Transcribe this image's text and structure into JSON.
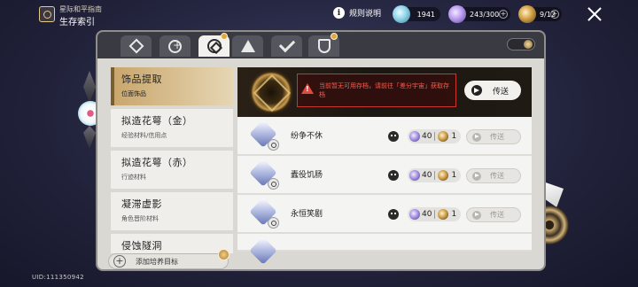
{
  "header": {
    "guide_title": "星际和平指南",
    "guide_subtitle": "生存索引",
    "rules_label": "规则说明",
    "resources": [
      {
        "value": "1941",
        "icon": "stellar-jade-icon"
      },
      {
        "value": "243/300",
        "icon": "trailblaze-power-icon"
      },
      {
        "value": "9/12",
        "icon": "fuel-icon"
      }
    ]
  },
  "sidebar": {
    "items": [
      {
        "name": "饰品提取",
        "sub": "位面饰品",
        "active": true
      },
      {
        "name": "拟造花萼（金）",
        "sub": "经验材料/信用点"
      },
      {
        "name": "拟造花萼（赤）",
        "sub": "行迹材料"
      },
      {
        "name": "凝滞虚影",
        "sub": "角色晋阶材料"
      },
      {
        "name": "侵蚀隧洞",
        "sub": ""
      }
    ],
    "add_target": "添加培养目标"
  },
  "banner": {
    "warning": "当前暂无可用存档，请前往「差分宇宙」获取存档",
    "send_label": "传送"
  },
  "rows": [
    {
      "name": "纷争不休",
      "cost": "40",
      "count": "1",
      "send": "传送"
    },
    {
      "name": "蠹役饥肠",
      "cost": "40",
      "count": "1",
      "send": "传送"
    },
    {
      "name": "永恒笑剧",
      "cost": "40",
      "count": "1",
      "send": "传送"
    }
  ],
  "uid": "UID:111350942",
  "colors": {
    "accent_gold": "#c9a56a",
    "warning_red": "#e04a3d"
  }
}
